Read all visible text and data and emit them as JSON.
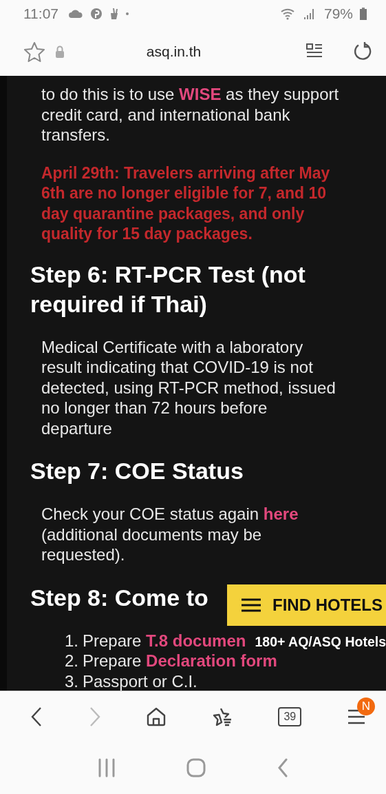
{
  "status_bar": {
    "time": "11:07",
    "battery": "79%"
  },
  "browser": {
    "url": "asq.in.th"
  },
  "content": [
    {
      "kind": "paragraph",
      "segments": [
        {
          "text": "to do this is to use "
        },
        {
          "link": "WISE"
        },
        {
          "text": " as they support credit card, and international bank transfers."
        }
      ]
    },
    {
      "kind": "notice",
      "text": "April 29th: Travelers arriving after May 6th are no longer eligible for 7, and 10 day quarantine packages, and only quality for 15 day packages."
    },
    {
      "kind": "heading",
      "text": "Step 6: RT-PCR Test (not required if Thai)"
    },
    {
      "kind": "paragraph",
      "segments": [
        {
          "text": "Medical Certificate with a laboratory result indicating that COVID-19 is not detected, using RT-PCR method, issued no longer than 72 hours before departure"
        }
      ]
    },
    {
      "kind": "heading",
      "text": "Step 7: COE Status"
    },
    {
      "kind": "paragraph",
      "segments": [
        {
          "text": "Check your COE status again "
        },
        {
          "link": "here"
        },
        {
          "text": " (additional documents may be requested)."
        }
      ]
    },
    {
      "kind": "heading",
      "text": "Step 8: Come to"
    },
    {
      "kind": "list",
      "items": [
        {
          "number": "1.",
          "segments": [
            {
              "text": "Prepare "
            },
            {
              "link": "T.8 documen"
            }
          ]
        },
        {
          "number": "2.",
          "segments": [
            {
              "text": "Prepare "
            },
            {
              "link": "Declaration form"
            }
          ]
        },
        {
          "number": "3.",
          "segments": [
            {
              "text": "Passport or C.I."
            }
          ]
        }
      ]
    }
  ],
  "floating_panel": {
    "button": "FIND HOTELS",
    "caption": "180+ AQ/ASQ Hotels"
  },
  "bottom_bar": {
    "back_disabled": false,
    "forward_disabled": true,
    "tab_count": "39",
    "menu_badge": "N"
  }
}
